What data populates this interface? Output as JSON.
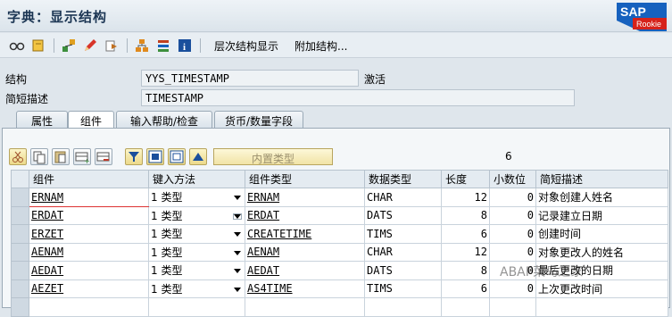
{
  "window": {
    "title": "字典：显示结构",
    "logo_text": "SAP",
    "logo_sub": "Rookie"
  },
  "toolbar": {
    "hierarchy_label": "层次结构显示",
    "append_label": "附加结构..."
  },
  "form": {
    "structure_label": "结构",
    "structure_value": "YYS_TIMESTAMP",
    "status": "激活",
    "desc_label": "简短描述",
    "desc_value": "TIMESTAMP"
  },
  "tabs": [
    {
      "label": "属性",
      "active": false
    },
    {
      "label": "组件",
      "active": true
    },
    {
      "label": "输入帮助/检查",
      "active": false
    },
    {
      "label": "货币/数量字段",
      "active": false
    }
  ],
  "table_toolbar": {
    "builtin_type_label": "内置类型",
    "count": "6"
  },
  "table": {
    "columns": [
      "组件",
      "键入方法",
      "组件类型",
      "数据类型",
      "长度",
      "小数位",
      "简短描述"
    ],
    "rows": [
      {
        "component": "ERNAM",
        "method": "1 类型",
        "comp_type": "ERNAM",
        "data_type": "CHAR",
        "length": "12",
        "decimals": "0",
        "desc": "对象创建人姓名"
      },
      {
        "component": "ERDAT",
        "method": "1 类型",
        "comp_type": "ERDAT",
        "data_type": "DATS",
        "length": "8",
        "decimals": "0",
        "desc": "记录建立日期"
      },
      {
        "component": "ERZET",
        "method": "1 类型",
        "comp_type": "CREATETIME",
        "data_type": "TIMS",
        "length": "6",
        "decimals": "0",
        "desc": "创建时间"
      },
      {
        "component": "AENAM",
        "method": "1 类型",
        "comp_type": "AENAM",
        "data_type": "CHAR",
        "length": "12",
        "decimals": "0",
        "desc": "对象更改人的姓名"
      },
      {
        "component": "AEDAT",
        "method": "1 类型",
        "comp_type": "AEDAT",
        "data_type": "DATS",
        "length": "8",
        "decimals": "0",
        "desc": "最后更改的日期"
      },
      {
        "component": "AEZET",
        "method": "1 类型",
        "comp_type": "AS4TIME",
        "data_type": "TIMS",
        "length": "6",
        "decimals": "0",
        "desc": "上次更改时间"
      }
    ]
  },
  "watermark": "ABAP菜鸟之家",
  "colors": {
    "title": "#1b3553",
    "logo_blue": "#1661be",
    "logo_red": "#d6221a"
  }
}
